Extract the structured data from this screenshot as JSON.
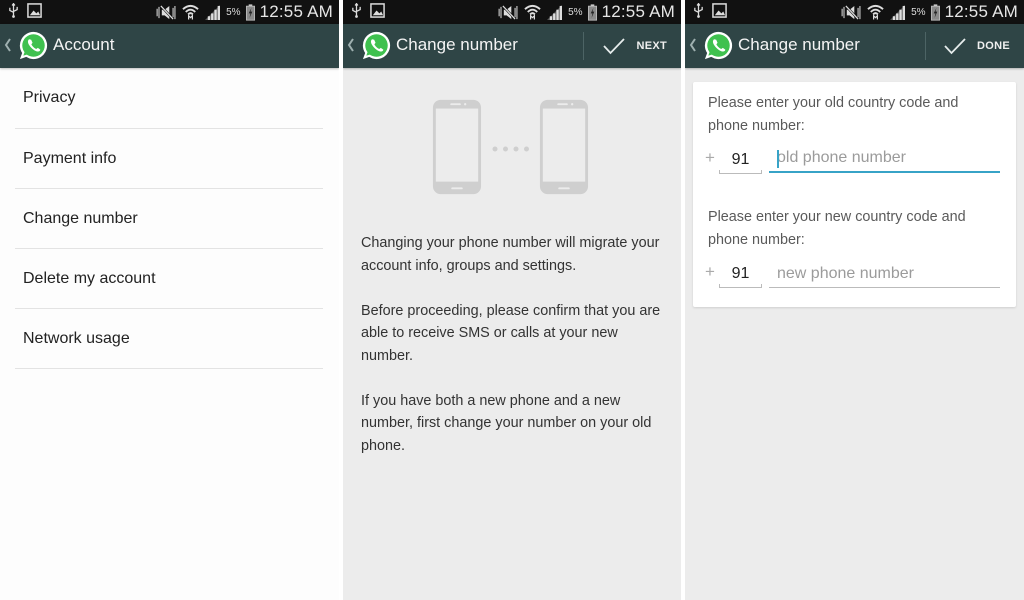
{
  "status_bar": {
    "time": "12:55 AM",
    "battery_percent": "5%",
    "icons": [
      "usb-icon",
      "gallery-icon",
      "mute-icon",
      "wifi-icon",
      "signal-icon",
      "battery-charging-icon"
    ]
  },
  "colors": {
    "appbar": "#2f4546",
    "accent": "#37a3c7",
    "whatsapp_green": "#3fc14f"
  },
  "screens": [
    {
      "title": "Account",
      "menu_items": [
        {
          "label": "Privacy"
        },
        {
          "label": "Payment info"
        },
        {
          "label": "Change number"
        },
        {
          "label": "Delete my account"
        },
        {
          "label": "Network usage"
        }
      ]
    },
    {
      "title": "Change number",
      "action_label": "NEXT",
      "paragraphs": [
        "Changing your phone number will migrate your account info, groups and settings.",
        "Before proceeding, please confirm that you are able to receive SMS or calls at your new number.",
        "If you have both a new phone and a new number, first change your number on your old phone."
      ]
    },
    {
      "title": "Change number",
      "action_label": "DONE",
      "old": {
        "prompt": "Please enter your old country code and phone number:",
        "plus": "+",
        "country_code": "91",
        "placeholder": "old phone number",
        "value": ""
      },
      "new": {
        "prompt": "Please enter your new country code and phone number:",
        "plus": "+",
        "country_code": "91",
        "placeholder": "new phone number",
        "value": ""
      }
    }
  ]
}
